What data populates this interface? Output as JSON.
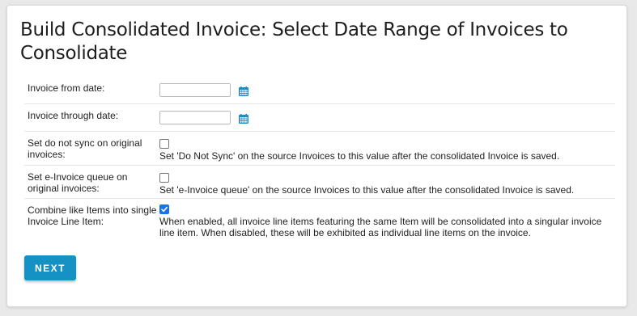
{
  "page": {
    "title": "Build Consolidated Invoice: Select Date Range of Invoices to Consolidate"
  },
  "form": {
    "from_date": {
      "label": "Invoice from date:",
      "value": "",
      "icon": "calendar-icon"
    },
    "through_date": {
      "label": "Invoice through date:",
      "value": "",
      "icon": "calendar-icon"
    },
    "do_not_sync": {
      "label": "Set do not sync on original invoices:",
      "checked": false,
      "help": "Set 'Do Not Sync' on the source Invoices to this value after the consolidated Invoice is saved."
    },
    "einvoice_queue": {
      "label": "Set e-Invoice queue on original invoices:",
      "checked": false,
      "help": "Set 'e-Invoice queue' on the source Invoices to this value after the consolidated Invoice is saved."
    },
    "combine_items": {
      "label": "Combine like Items into single Invoice Line Item:",
      "checked": true,
      "help": "When enabled, all invoice line items featuring the same Item will be consolidated into a singular invoice line item. When disabled, these will be exhibited as individual line items on the invoice."
    }
  },
  "actions": {
    "next_label": "NEXT"
  },
  "colors": {
    "accent": "#1591c4",
    "calendar": "#1a8fc6",
    "checkbox_checked": "#1a73e8"
  }
}
